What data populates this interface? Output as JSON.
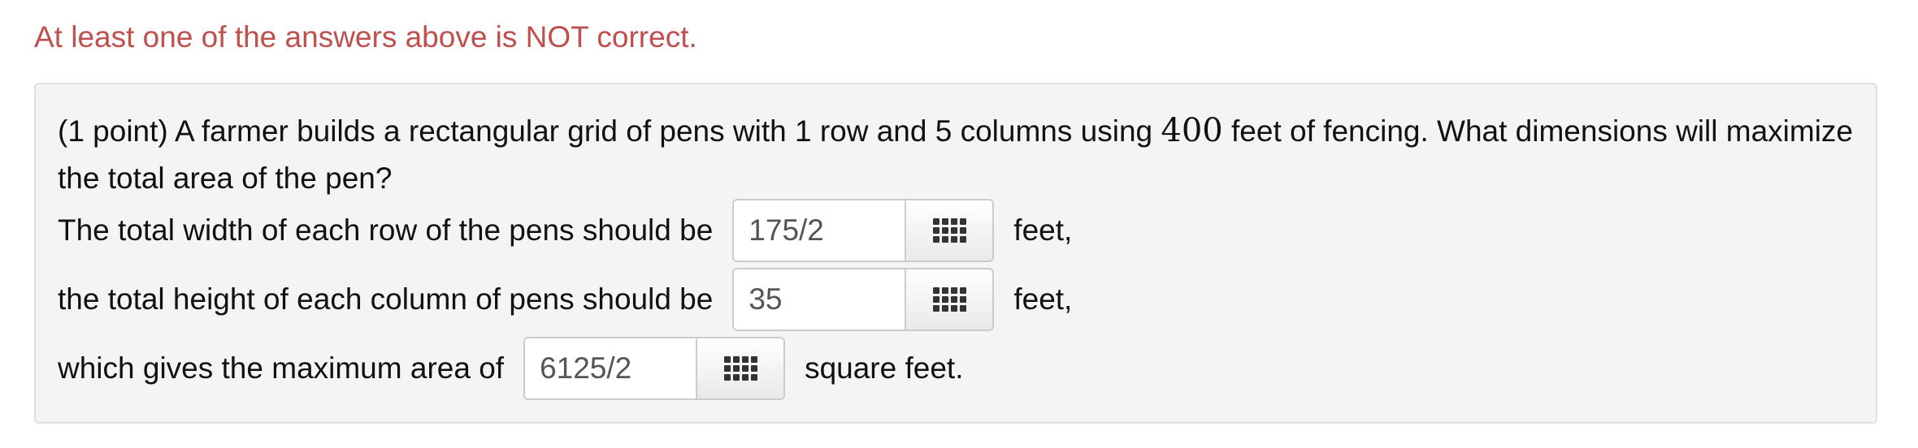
{
  "status_message": "At least one of the answers above is NOT correct.",
  "problem": {
    "prompt_before": "(1 point) A farmer builds a rectangular grid of pens with 1 row and 5 columns using",
    "fence_length": "400",
    "prompt_after": "feet of fencing. What dimensions will maximize the total area of the pen?"
  },
  "answers": [
    {
      "prefix": "The total width of each row of the pens should be",
      "value": "175/2",
      "suffix": "feet,"
    },
    {
      "prefix": "the total height of each column of pens should be",
      "value": "35",
      "suffix": "feet,"
    },
    {
      "prefix": "which gives the maximum area of",
      "value": "6125/2",
      "suffix": "square feet."
    }
  ],
  "icons": {
    "palette_button": "equation-palette-icon"
  },
  "colors": {
    "error_text": "#c0504d",
    "well_background": "#f4f4f4",
    "input_text": "#555555"
  }
}
